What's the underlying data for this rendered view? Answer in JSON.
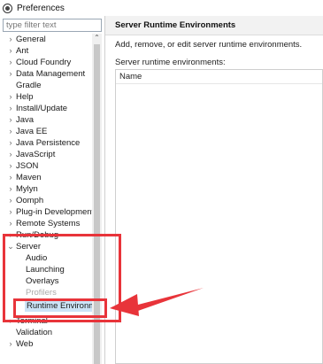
{
  "window": {
    "title": "Preferences"
  },
  "filter": {
    "placeholder": "type filter text"
  },
  "tree": {
    "items": [
      {
        "label": "General",
        "arrow": "›"
      },
      {
        "label": "Ant",
        "arrow": "›"
      },
      {
        "label": "Cloud Foundry",
        "arrow": "›"
      },
      {
        "label": "Data Management",
        "arrow": "›"
      },
      {
        "label": "Gradle",
        "arrow": ""
      },
      {
        "label": "Help",
        "arrow": "›"
      },
      {
        "label": "Install/Update",
        "arrow": "›"
      },
      {
        "label": "Java",
        "arrow": "›"
      },
      {
        "label": "Java EE",
        "arrow": "›"
      },
      {
        "label": "Java Persistence",
        "arrow": "›"
      },
      {
        "label": "JavaScript",
        "arrow": "›"
      },
      {
        "label": "JSON",
        "arrow": "›"
      },
      {
        "label": "Maven",
        "arrow": "›"
      },
      {
        "label": "Mylyn",
        "arrow": "›"
      },
      {
        "label": "Oomph",
        "arrow": "›"
      },
      {
        "label": "Plug-in Development",
        "arrow": "›"
      },
      {
        "label": "Remote Systems",
        "arrow": "›"
      },
      {
        "label": "Run/Debug",
        "arrow": "›"
      },
      {
        "label": "Server",
        "arrow": "⌄"
      }
    ],
    "server_children": [
      {
        "label": "Audio"
      },
      {
        "label": "Launching"
      },
      {
        "label": "Overlays"
      },
      {
        "label": "Profilers"
      },
      {
        "label": "Runtime Environme"
      }
    ],
    "after_items": [
      {
        "label": "Terminal",
        "arrow": "›"
      },
      {
        "label": "Validation",
        "arrow": ""
      },
      {
        "label": "Web",
        "arrow": "›"
      }
    ]
  },
  "main": {
    "title": "Server Runtime Environments",
    "description": "Add, remove, or edit server runtime environments.",
    "section_label": "Server runtime environments:",
    "table": {
      "columns": [
        "Name"
      ]
    }
  },
  "colors": {
    "annotation": "#e8343a",
    "selection": "#cce4f7",
    "header_bg": "#f2f2f2"
  }
}
